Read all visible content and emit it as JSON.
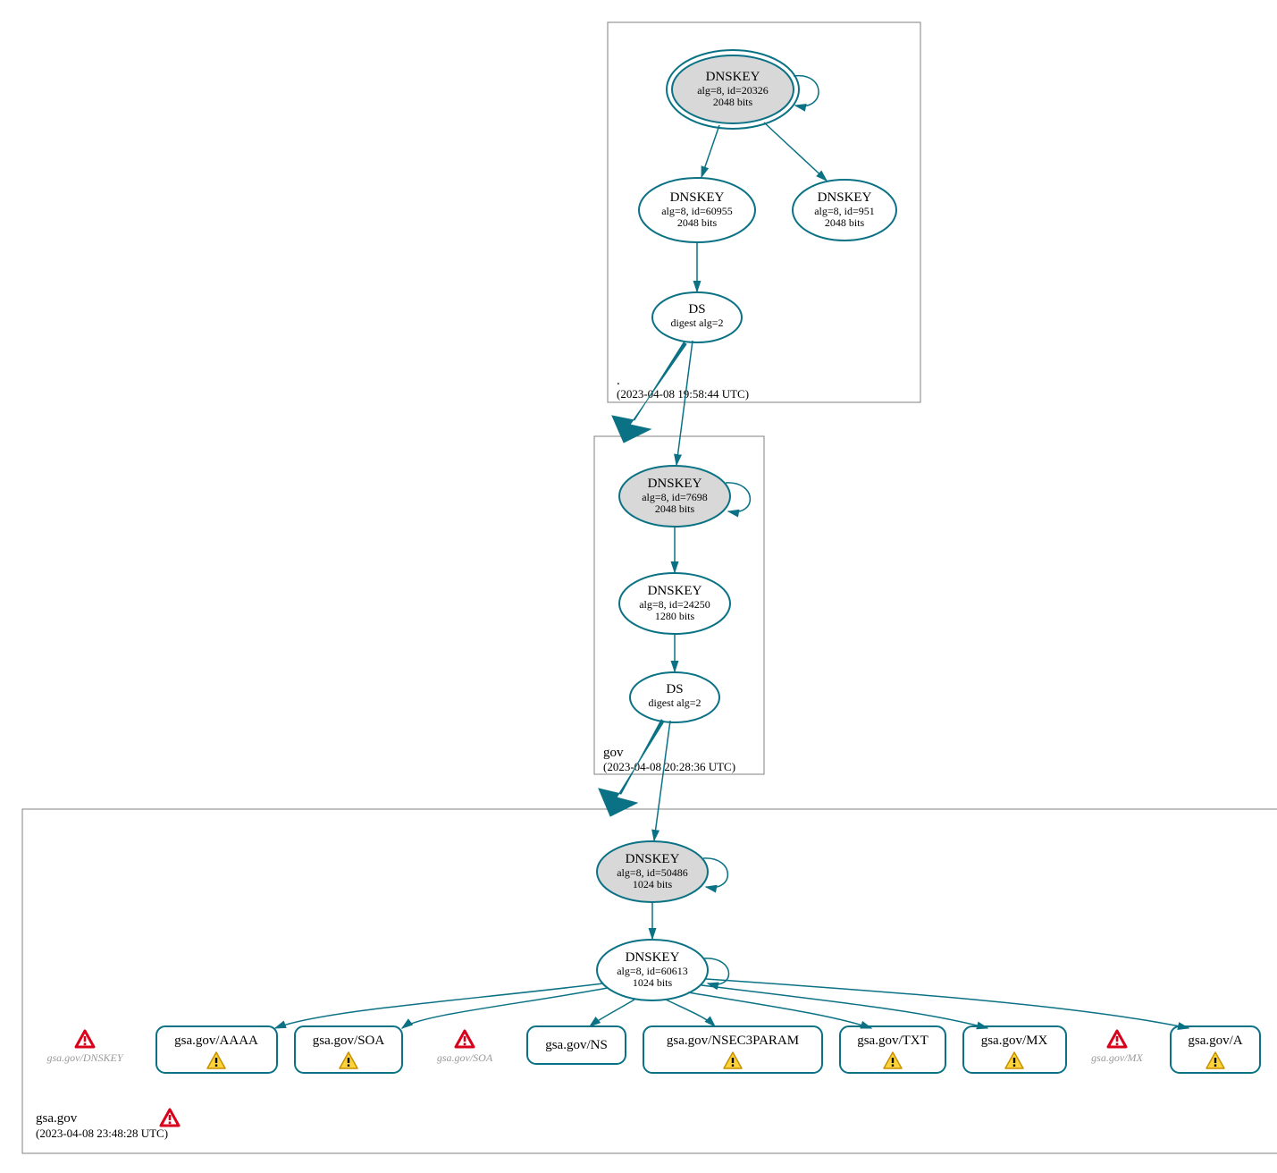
{
  "zones": {
    "root": {
      "label": ".",
      "timestamp": "(2023-04-08 19:58:44 UTC)",
      "nodes": {
        "ksk": {
          "title": "DNSKEY",
          "line1": "alg=8, id=20326",
          "line2": "2048 bits"
        },
        "zsk": {
          "title": "DNSKEY",
          "line1": "alg=8, id=60955",
          "line2": "2048 bits"
        },
        "other": {
          "title": "DNSKEY",
          "line1": "alg=8, id=951",
          "line2": "2048 bits"
        },
        "ds": {
          "title": "DS",
          "line1": "digest alg=2"
        }
      }
    },
    "gov": {
      "label": "gov",
      "timestamp": "(2023-04-08 20:28:36 UTC)",
      "nodes": {
        "ksk": {
          "title": "DNSKEY",
          "line1": "alg=8, id=7698",
          "line2": "2048 bits"
        },
        "zsk": {
          "title": "DNSKEY",
          "line1": "alg=8, id=24250",
          "line2": "1280 bits"
        },
        "ds": {
          "title": "DS",
          "line1": "digest alg=2"
        }
      }
    },
    "gsa": {
      "label": "gsa.gov",
      "timestamp": "(2023-04-08 23:48:28 UTC)",
      "nodes": {
        "ksk": {
          "title": "DNSKEY",
          "line1": "alg=8, id=50486",
          "line2": "1024 bits"
        },
        "zsk": {
          "title": "DNSKEY",
          "line1": "alg=8, id=60613",
          "line2": "1024 bits"
        }
      },
      "rrsets": {
        "aaaa": "gsa.gov/AAAA",
        "soa": "gsa.gov/SOA",
        "ns": "gsa.gov/NS",
        "nsec3": "gsa.gov/NSEC3PARAM",
        "txt": "gsa.gov/TXT",
        "mx": "gsa.gov/MX",
        "a": "gsa.gov/A"
      },
      "ghosts": {
        "dnskey": "gsa.gov/DNSKEY",
        "soa": "gsa.gov/SOA",
        "mx": "gsa.gov/MX"
      }
    }
  }
}
